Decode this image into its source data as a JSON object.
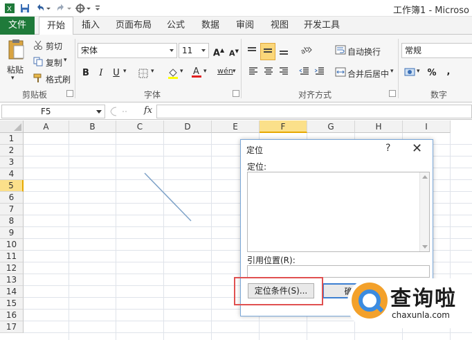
{
  "titlebar": {
    "title": "工作簿1 - Microso",
    "quick_access": [
      "save-icon",
      "undo-icon",
      "redo-icon",
      "customize-icon"
    ]
  },
  "tabs": [
    {
      "label": "文件",
      "kind": "file"
    },
    {
      "label": "开始",
      "kind": "active"
    },
    {
      "label": "插入"
    },
    {
      "label": "页面布局"
    },
    {
      "label": "公式"
    },
    {
      "label": "数据"
    },
    {
      "label": "审阅"
    },
    {
      "label": "视图"
    },
    {
      "label": "开发工具"
    }
  ],
  "ribbon": {
    "clipboard": {
      "paste": "粘贴",
      "cut": "剪切",
      "copy": "复制",
      "format_painter": "格式刷",
      "group_label": "剪贴板"
    },
    "font": {
      "font_name": "宋体",
      "font_size": "11",
      "bold": "B",
      "italic": "I",
      "underline": "U",
      "grow": "A",
      "shrink": "A",
      "font_color_letter": "A",
      "phonetic": "wén",
      "group_label": "字体"
    },
    "alignment": {
      "wrap_text": "自动换行",
      "merge_center": "合并后居中",
      "group_label": "对齐方式"
    },
    "number": {
      "format": "常规",
      "percent": "%",
      "comma": ",",
      "group_label": "数字"
    }
  },
  "formula_bar": {
    "name_box": "F5",
    "fx": "fx",
    "value": ""
  },
  "grid": {
    "columns": [
      "A",
      "B",
      "C",
      "D",
      "E",
      "F",
      "G",
      "H",
      "I"
    ],
    "rows": [
      "1",
      "2",
      "3",
      "4",
      "5",
      "6",
      "7",
      "8",
      "9",
      "10",
      "11",
      "12",
      "13",
      "14",
      "15",
      "16",
      "17"
    ],
    "selected_column": "F",
    "selected_row": "5"
  },
  "dialog": {
    "title": "定位",
    "help": "?",
    "close": "✕",
    "goto_label": "定位:",
    "reference_label": "引用位置(R):",
    "reference_value": "",
    "special_button": "定位条件(S)...",
    "ok_button": "确"
  },
  "watermark": {
    "chinese": "查询啦",
    "url": "chaxunla.com"
  },
  "colors": {
    "file_tab": "#1f7a3a",
    "selection_header": "#fbe08a",
    "highlight_box": "#e05050",
    "watermark_orange": "#f3a12b",
    "watermark_blue": "#3b8be0"
  }
}
